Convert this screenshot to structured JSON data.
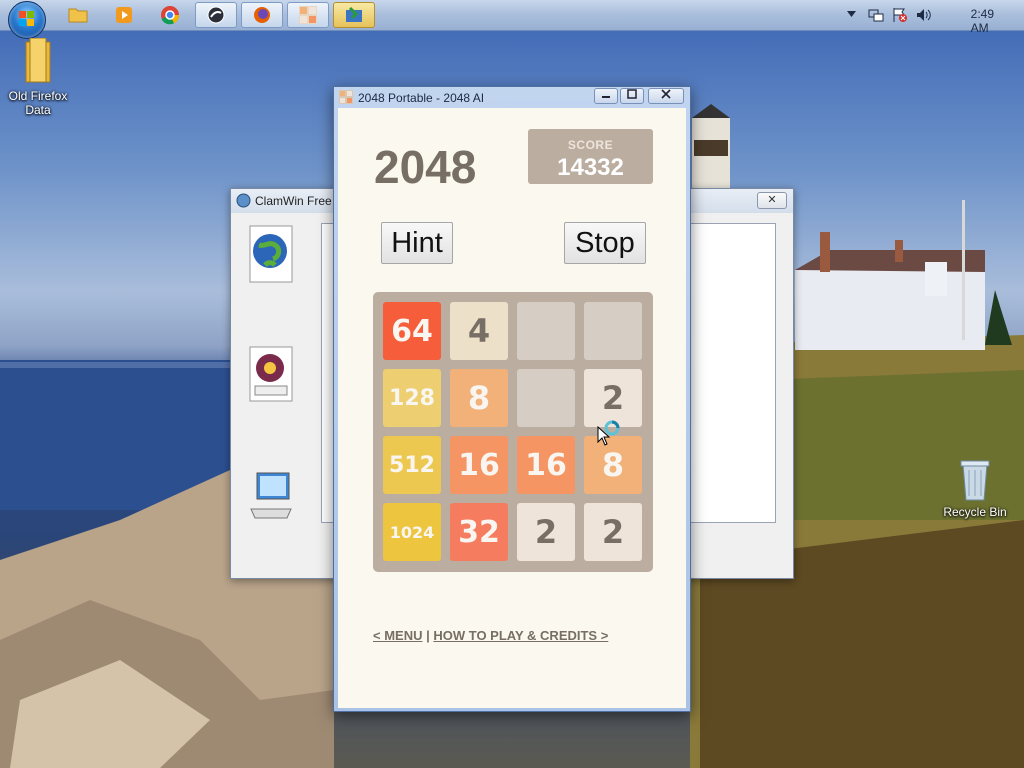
{
  "taskbar": {
    "clock": "2:49 AM",
    "buttons": [
      "file-explorer",
      "media-player",
      "chrome",
      "browser-app",
      "firefox",
      "game-app",
      "program-app"
    ]
  },
  "desktop": {
    "icons": [
      {
        "label_line1": "Old Firefox",
        "label_line2": "Data"
      },
      {
        "label_line1": "Recycle Bin",
        "label_line2": ""
      }
    ]
  },
  "clamwin": {
    "title": "ClamWin Free",
    "close_label": "✕"
  },
  "game_window": {
    "title": "2048 Portable - 2048 AI",
    "logo": "2048",
    "score_label": "SCORE",
    "score_value": "14332",
    "hint_label": "Hint",
    "stop_label": "Stop",
    "menu_link": "< MENU",
    "separator": "|",
    "credits_link": "HOW TO PLAY & CREDITS >"
  },
  "board": {
    "rows": [
      [
        "64",
        "4",
        "",
        ""
      ],
      [
        "128",
        "8",
        "",
        "2"
      ],
      [
        "512",
        "16",
        "16",
        "8"
      ],
      [
        "1024",
        "32",
        "2",
        "2"
      ]
    ]
  },
  "colors": {
    "board": "#bbada0",
    "background": "#faf8ef",
    "text_dark": "#776e65"
  }
}
